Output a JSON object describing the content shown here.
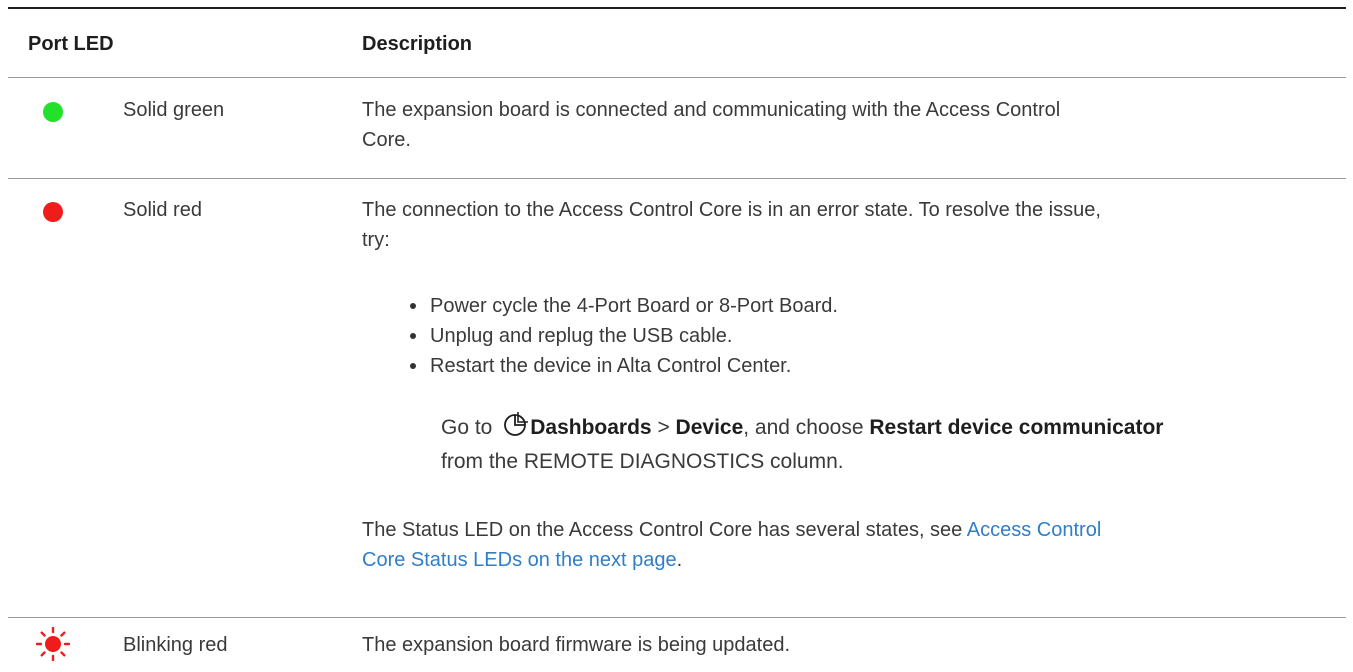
{
  "table": {
    "headers": {
      "port_led": "Port LED",
      "description": "Description"
    },
    "rows": [
      {
        "led_color": "#23e12a",
        "icon": "solid-green-dot-icon",
        "label": "Solid green",
        "desc_line1": "The expansion board is connected and communicating with the Access Control",
        "desc_line2": "Core."
      },
      {
        "led_color": "#f01c1c",
        "icon": "solid-red-dot-icon",
        "label": "Solid red",
        "desc_line1": "The connection to the Access Control Core is in an error state. To resolve the issue,",
        "desc_line2": "try:",
        "bullets": [
          "Power cycle the 4-Port Board or 8-Port Board.",
          "Unplug and replug the USB cable.",
          "Restart the device in Alta Control Center."
        ],
        "goto": {
          "prefix": "Go to",
          "icon": "dashboards-icon",
          "dashboards": "Dashboards",
          "sep": ">",
          "device": "Device",
          "mid": ", and choose",
          "action": "Restart device communicator",
          "suffix": "from the REMOTE DIAGNOSTICS column."
        },
        "note_line1_prefix": "The Status LED on the Access Control Core has several states, see",
        "note_link_part1": "Access Control",
        "note_link_part2": "Core Status LEDs on the next page",
        "note_end": "."
      },
      {
        "led_color": "#f01c1c",
        "icon": "blinking-red-icon",
        "label": "Blinking red",
        "desc_line1": "The expansion board firmware is being updated."
      }
    ]
  }
}
